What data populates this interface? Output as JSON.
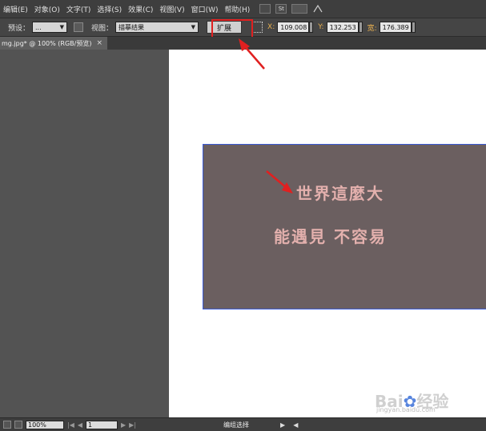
{
  "menubar": {
    "items": [
      "编辑(E)",
      "对象(O)",
      "文字(T)",
      "选择(S)",
      "效果(C)",
      "视图(V)",
      "窗口(W)",
      "帮助(H)"
    ],
    "st_label": "St"
  },
  "toolbar": {
    "preset_label": "预设：",
    "preset_value": "...",
    "view_label": "视图：",
    "view_value": "描摹结果",
    "expand_label": "扩展",
    "x_label": "X:",
    "x_value": "109.008",
    "y_label": "Y:",
    "y_value": "132.253",
    "w_label": "宽:",
    "w_value": "176.389"
  },
  "document": {
    "tab_title": "mg.jpg* @ 100% (RGB/预览)",
    "close_glyph": "×"
  },
  "artwork": {
    "line1": "世界這麼大",
    "line2": "能遇見 不容易"
  },
  "statusbar": {
    "zoom": "100%",
    "page": "1",
    "status_text": "编组选择"
  },
  "watermark": {
    "brand": "Bai",
    "brand_cn": "经验",
    "url": "jingyan.baidu.com"
  },
  "colors": {
    "highlight": "#e02020",
    "arrow": "#e02020",
    "text": "#e3b0ad",
    "image_bg": "#6b5f60"
  }
}
